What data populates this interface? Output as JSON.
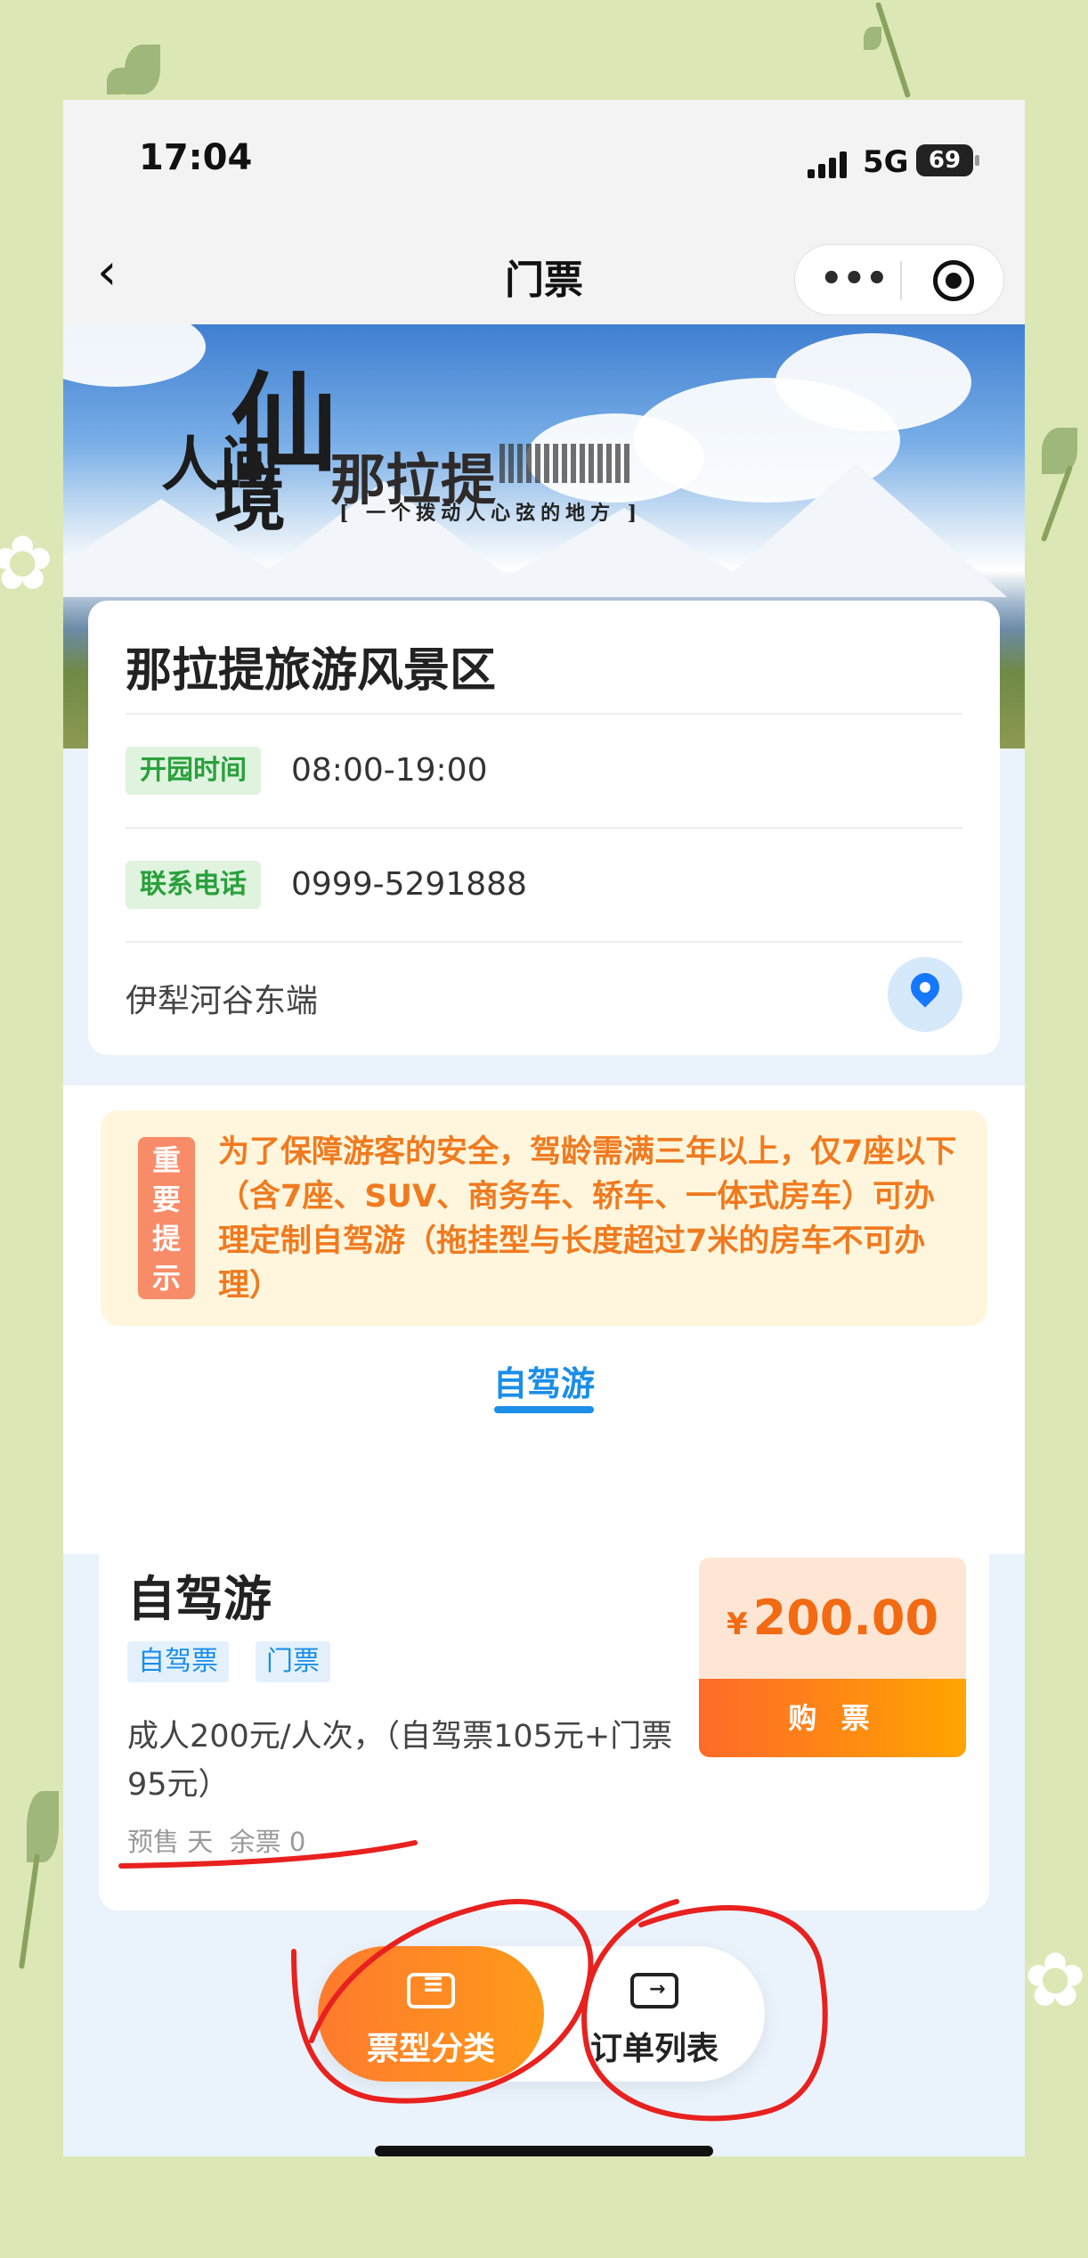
{
  "status_bar": {
    "time": "17:04",
    "network": "5G",
    "battery": "69"
  },
  "nav": {
    "title": "门票",
    "more_icon": "ellipsis-icon",
    "target_icon": "target-icon",
    "back_icon": "back-arrow-icon"
  },
  "banner": {
    "calligraphy_a": "人间",
    "calligraphy_b": "仙",
    "calligraphy_c": "境",
    "calligraphy_d": "那拉提",
    "slogan": "[ 一个拨动人心弦的地方 ]"
  },
  "scenic": {
    "name": "那拉提旅游风景区",
    "open_label": "开园时间",
    "open_time": "08:00-19:00",
    "phone_label": "联系电话",
    "phone": "0999-5291888",
    "address": "伊犁河谷东端",
    "location_icon": "location-pin-icon"
  },
  "notice": {
    "badge_chars": [
      "重",
      "要",
      "提",
      "示"
    ],
    "text": "为了保障游客的安全，驾龄需满三年以上，仅7座以下（含7座、SUV、商务车、轿车、一体式房车）可办理定制自驾游（拖挂型与长度超过7米的房车不可办理）"
  },
  "tabs": [
    {
      "label": "自驾游",
      "active": true
    }
  ],
  "ticket": {
    "name": "自驾游",
    "tags": [
      "自驾票",
      "门票"
    ],
    "description": "成人200元/人次，（自驾票105元+门票95元）",
    "meta": "预售 天  余票 0",
    "currency": "¥",
    "price": "200.00",
    "buy_label": "购 票"
  },
  "bottom_nav": [
    {
      "label": "票型分类",
      "icon": "ticket-category-icon",
      "active": true
    },
    {
      "label": "订单列表",
      "icon": "order-list-icon",
      "active": false
    }
  ],
  "colors": {
    "accent_blue": "#1a8ee8",
    "price_orange": "#f26a12",
    "annotation_red": "#e8211f",
    "background": "#dce7b6"
  }
}
